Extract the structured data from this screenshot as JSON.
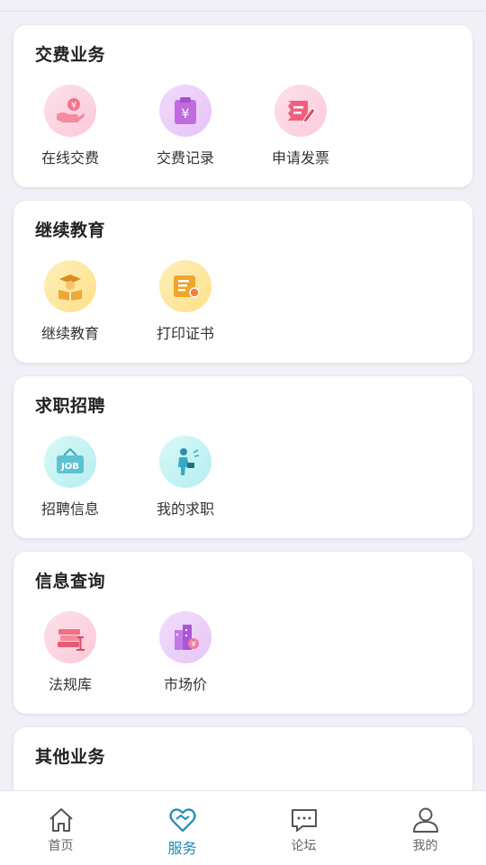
{
  "sections": [
    {
      "title": "交费业务",
      "items": [
        {
          "label": "在线交费",
          "icon": "hand-coin-icon"
        },
        {
          "label": "交费记录",
          "icon": "clipboard-yen-icon"
        },
        {
          "label": "申请发票",
          "icon": "invoice-pen-icon"
        }
      ]
    },
    {
      "title": "继续教育",
      "items": [
        {
          "label": "继续教育",
          "icon": "graduate-book-icon"
        },
        {
          "label": "打印证书",
          "icon": "certificate-icon"
        }
      ]
    },
    {
      "title": "求职招聘",
      "items": [
        {
          "label": "招聘信息",
          "icon": "job-sign-icon"
        },
        {
          "label": "我的求职",
          "icon": "job-seeker-icon"
        }
      ]
    },
    {
      "title": "信息查询",
      "items": [
        {
          "label": "法规库",
          "icon": "law-books-icon"
        },
        {
          "label": "市场价",
          "icon": "building-price-icon"
        }
      ]
    },
    {
      "title": "其他业务",
      "items": []
    }
  ],
  "nav": {
    "items": [
      {
        "label": "首页",
        "icon": "home-icon"
      },
      {
        "label": "服务",
        "icon": "service-heart-icon"
      },
      {
        "label": "论坛",
        "icon": "forum-chat-icon"
      },
      {
        "label": "我的",
        "icon": "user-icon"
      }
    ],
    "active_color": "#1e88b8",
    "inactive_color": "#666666"
  }
}
